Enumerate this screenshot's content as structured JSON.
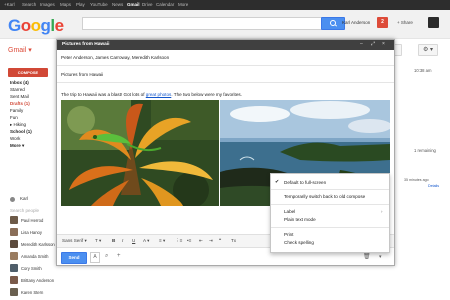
{
  "topbar": {
    "items": [
      "+Karl",
      "Search",
      "Images",
      "Maps",
      "Play",
      "YouTube",
      "News",
      "Gmail",
      "Drive",
      "Calendar",
      "More"
    ]
  },
  "header": {
    "logo": "Google",
    "user": "Karl Anderson",
    "notifications": "2",
    "share": "+ Share"
  },
  "app_label": "Gmail ▾",
  "sidebar": {
    "compose": "COMPOSE",
    "items": [
      "Inbox (4)",
      "Starred",
      "Sent Mail",
      "Drafts (1)",
      "Family",
      "Fun",
      "▸ Hiking",
      "School (1)",
      "Work",
      "More ▾"
    ]
  },
  "chat": {
    "self": "Karl",
    "search": "Search people",
    "contacts": [
      "Paul Herrod",
      "Lisa Hanoy",
      "Meredith Karlsson",
      "Amanda Smith",
      "Cory Smith",
      "Brittany Anderson",
      "Karen Stern"
    ]
  },
  "background_right": {
    "time": "10:38 am",
    "remaining": "1 remaining",
    "activity": "35 minutes ago",
    "details": "Details"
  },
  "compose": {
    "title": "Pictures from Hawaii",
    "to": "Peter Anderson, James Carroway, Meredith Karlsoon",
    "subject": "Pictures from Hawaii",
    "body_before": "The trip to Hawaii was a blast!  Got lots of ",
    "body_link": "great photos",
    "body_after": ".  The two below were my favorites.",
    "toolbar": {
      "font": "Sans Serif ▾",
      "size": "T ▾",
      "bold": "B",
      "italic": "I",
      "underline": "U",
      "color": "A ▾",
      "align": "≡ ▾",
      "numbered": "⋮≡",
      "bulleted": "•≡",
      "indent_less": "⇤",
      "indent_more": "⇥",
      "quote": "❞",
      "clear": "Tx"
    },
    "send": "Send"
  },
  "context_menu": {
    "items": [
      "Default to full-screen",
      "Temporarily switch back to old compose",
      "Label",
      "Plain text mode",
      "Print",
      "Check spelling"
    ]
  },
  "icons": {
    "search": "search-icon",
    "gear": "gear-icon",
    "trash": "trash-icon",
    "attach": "paperclip-icon",
    "add": "plus-icon"
  },
  "colors": {
    "gmail_red": "#dd4b39",
    "blue_button": "#4b8ff0",
    "title_bar": "#404040"
  }
}
